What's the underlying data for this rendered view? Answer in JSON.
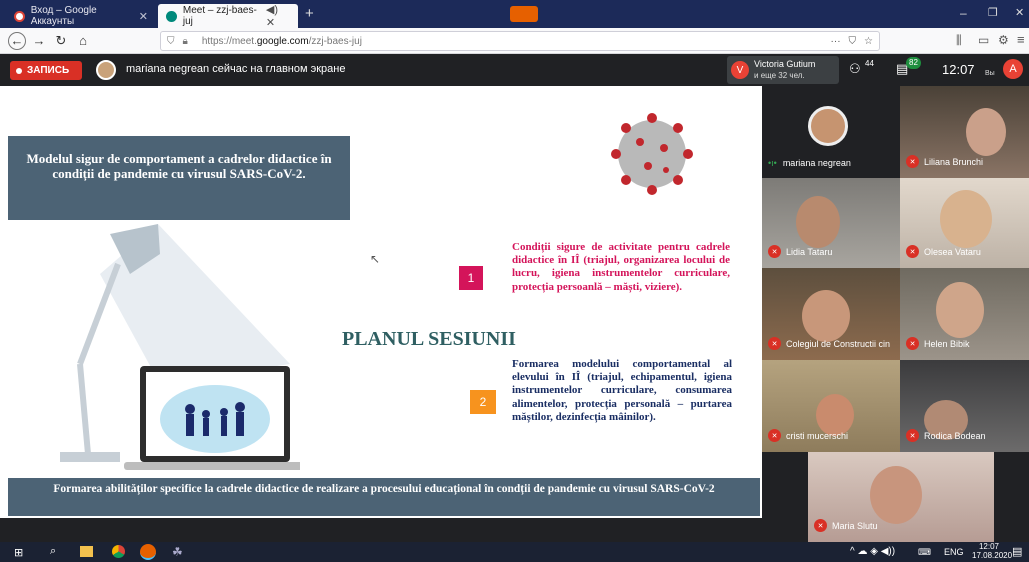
{
  "browser": {
    "tabs": [
      {
        "title": "Вход – Google Аккаунты",
        "active": false
      },
      {
        "title": "Meet – zzj-baes-juj",
        "active": true
      }
    ],
    "new_tab_label": "+",
    "url_prefix": "https://meet.",
    "url_domain": "google.com",
    "url_suffix": "/zzj-baes-juj",
    "menu_dots": "···"
  },
  "meet": {
    "record_label": "ЗАПИСЬ",
    "presenting_text": "mariana negrean сейчас на главном экране",
    "participants_name": "Victoria Gutium",
    "participants_more": "и еще 32 чел.",
    "people_count": "44",
    "chat_count": "82",
    "time": "12:07",
    "you_label": "Вы",
    "avatar_letter": "A",
    "avatar_letter_v": "V"
  },
  "slide": {
    "title_box": "Modelul sigur de comportament a cadrelor didactice în condiții de pandemie cu virusul SARS-CoV-2.",
    "item1_num": "1",
    "item1_text": "Condiții sigure de activitate pentru cadrele didactice în IÎ (triajul, organizarea locului de lucru, igiena instrumentelor curriculare, protecția persoanlă – măști, viziere).",
    "plan_title": "PLANUL SESIUNII",
    "item2_num": "2",
    "item2_text": "Formarea modelului comportamental al elevului în IÎ (triajul, echipamentul, igiena instrumentelor curriculare, consumarea alimentelor, protecția personală – purtarea măștilor, dezinfecția mâinilor).",
    "footer_text": "Formarea abilităților specifice la cadrele didactice de realizare a procesului educațional în condții de pandemie cu virusul SARS-CoV-2"
  },
  "participants": [
    {
      "name": "mariana negrean",
      "muted": false
    },
    {
      "name": "Liliana Brunchi",
      "muted": true
    },
    {
      "name": "Lidia Tataru",
      "muted": true
    },
    {
      "name": "Olesea Vataru",
      "muted": true
    },
    {
      "name": "Colegiul de Constructii cin",
      "muted": true
    },
    {
      "name": "Helen Bibik",
      "muted": true
    },
    {
      "name": "cristi mucerschi",
      "muted": true
    },
    {
      "name": "Rodica Bodean",
      "muted": true
    },
    {
      "name": "Maria Slutu",
      "muted": true
    }
  ],
  "taskbar": {
    "lang": "ENG",
    "time": "12:07",
    "date": "17.08.2020"
  },
  "colors": {
    "slide_title_bg": "#4c6375",
    "accent_red": "#d4145a",
    "accent_orange": "#f7931e",
    "plan_title": "#2f5f62",
    "record_red": "#d93025"
  }
}
